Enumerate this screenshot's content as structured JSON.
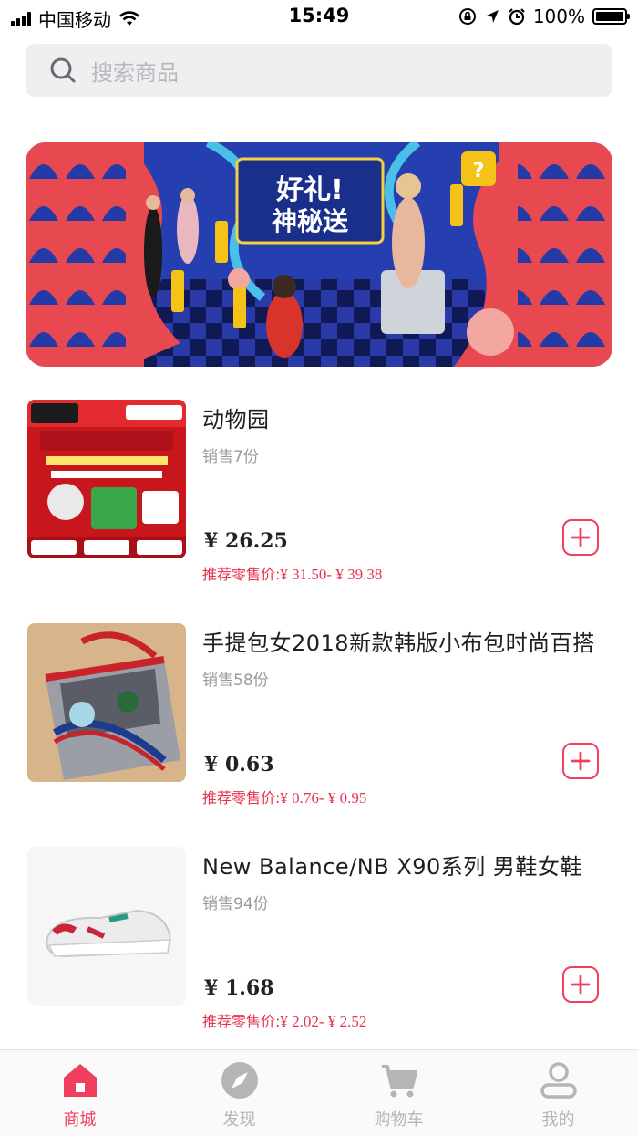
{
  "status_bar": {
    "carrier": "中国移动",
    "time": "15:49",
    "battery": "100%"
  },
  "search": {
    "placeholder": "搜索商品"
  },
  "colors": {
    "accent": "#f0405d",
    "price_text": "#e8334f",
    "inactive_tab": "#b5b5b5",
    "search_bg": "#efeff1"
  },
  "products": [
    {
      "title": "动物园",
      "sales": "销售7份",
      "price": "¥ 26.25",
      "retail_label": "推荐零售价:",
      "retail_range": "¥ 31.50- ¥ 39.38",
      "add_icon": "plus-icon"
    },
    {
      "title": "手提包女2018新款韩版小布包时尚百搭",
      "sales": "销售58份",
      "price": "¥ 0.63",
      "retail_label": "推荐零售价:",
      "retail_range": "¥ 0.76- ¥ 0.95",
      "add_icon": "plus-icon"
    },
    {
      "title": "New Balance/NB X90系列 男鞋女鞋",
      "sales": "销售94份",
      "price": "¥ 1.68",
      "retail_label": "推荐零售价:",
      "retail_range": "¥ 2.02- ¥ 2.52",
      "add_icon": "plus-icon"
    }
  ],
  "tabs": [
    {
      "label": "商城",
      "icon": "home-icon",
      "active": true
    },
    {
      "label": "发现",
      "icon": "compass-icon",
      "active": false
    },
    {
      "label": "购物车",
      "icon": "cart-icon",
      "active": false
    },
    {
      "label": "我的",
      "icon": "profile-icon",
      "active": false
    }
  ]
}
